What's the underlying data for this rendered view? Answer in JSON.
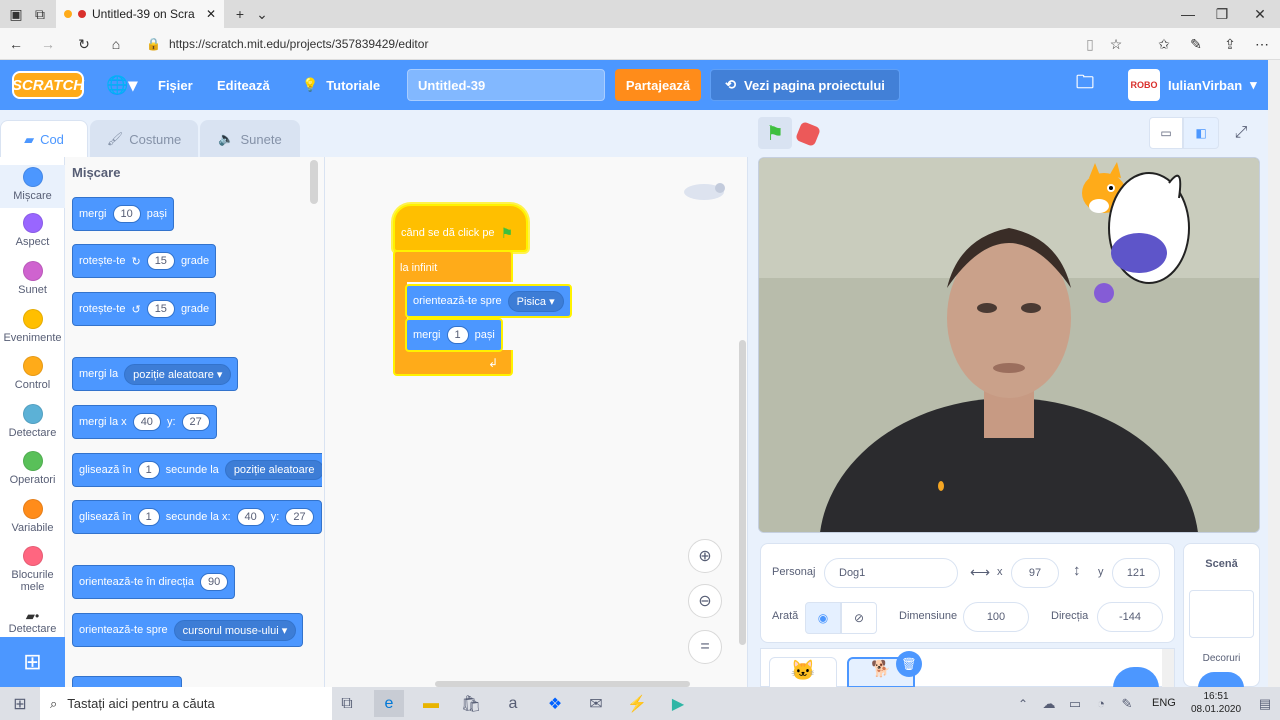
{
  "browser": {
    "tab_title": "Untitled-39 on Scra",
    "url": "https://scratch.mit.edu/projects/357839429/editor"
  },
  "menu": {
    "logo": "SCRATCH",
    "file": "Fișier",
    "edit": "Editează",
    "tutorials": "Tutoriale",
    "project_title": "Untitled-39",
    "share": "Partajează",
    "see_project_page": "Vezi pagina proiectului",
    "username": "IulianVirban"
  },
  "tabs": {
    "code": "Cod",
    "costumes": "Costume",
    "sounds": "Sunete"
  },
  "categories": [
    {
      "label": "Mișcare",
      "color": "#4c97ff"
    },
    {
      "label": "Aspect",
      "color": "#9966ff"
    },
    {
      "label": "Sunet",
      "color": "#cf63cf"
    },
    {
      "label": "Evenimente",
      "color": "#ffbf00"
    },
    {
      "label": "Control",
      "color": "#ffab19"
    },
    {
      "label": "Detectare",
      "color": "#5cb1d6"
    },
    {
      "label": "Operatori",
      "color": "#59c059"
    },
    {
      "label": "Variabile",
      "color": "#ff8c1a"
    },
    {
      "label": "Blocurile mele",
      "color": "#ff6680"
    },
    {
      "label": "Detectare",
      "color": "#4c97ff"
    }
  ],
  "palette": {
    "heading": "Mișcare",
    "move": {
      "label": "mergi",
      "value": "10",
      "unit": "pași"
    },
    "turn_right": {
      "label": "rotește-te",
      "value": "15",
      "unit": "grade"
    },
    "turn_left": {
      "label": "rotește-te",
      "value": "15",
      "unit": "grade"
    },
    "goto": {
      "label": "mergi la",
      "option": "poziție aleatoare"
    },
    "goto_xy": {
      "label": "mergi la x",
      "x": "40",
      "ylabel": "y:",
      "y": "27"
    },
    "glide_to": {
      "label": "glisează în",
      "secs": "1",
      "mid": "secunde la",
      "option": "poziție aleatoare"
    },
    "glide_xy": {
      "label": "glisează în",
      "secs": "1",
      "mid": "secunde la x:",
      "x": "40",
      "ylabel": "y:",
      "y": "27"
    },
    "point_dir": {
      "label": "orientează-te în direcția",
      "value": "90"
    },
    "point_towards": {
      "label": "orientează-te spre",
      "option": "cursorul mouse-ului"
    }
  },
  "script": {
    "hat": "când se dă click pe",
    "forever": "la infinit",
    "point_towards": "orientează-te spre",
    "point_option": "Pisica",
    "move": "mergi",
    "move_value": "1",
    "move_unit": "pași"
  },
  "sprite_info": {
    "sprite_label": "Personaj",
    "sprite_name": "Dog1",
    "x_label": "x",
    "x": "97",
    "y_label": "y",
    "y": "121",
    "show_label": "Arată",
    "size_label": "Dimensiune",
    "size": "100",
    "direction_label": "Direcția",
    "direction": "-144"
  },
  "stage_panel": {
    "title": "Scenă",
    "backdrops": "Decoruri"
  },
  "taskbar": {
    "search_placeholder": "Tastați aici pentru a căuta",
    "lang": "ENG",
    "time": "16:51",
    "date": "08.01.2020"
  },
  "colors": {
    "scratch_blue": "#4c97ff",
    "orange": "#ff8c1a",
    "control": "#ffab19",
    "events": "#ffbf00"
  }
}
